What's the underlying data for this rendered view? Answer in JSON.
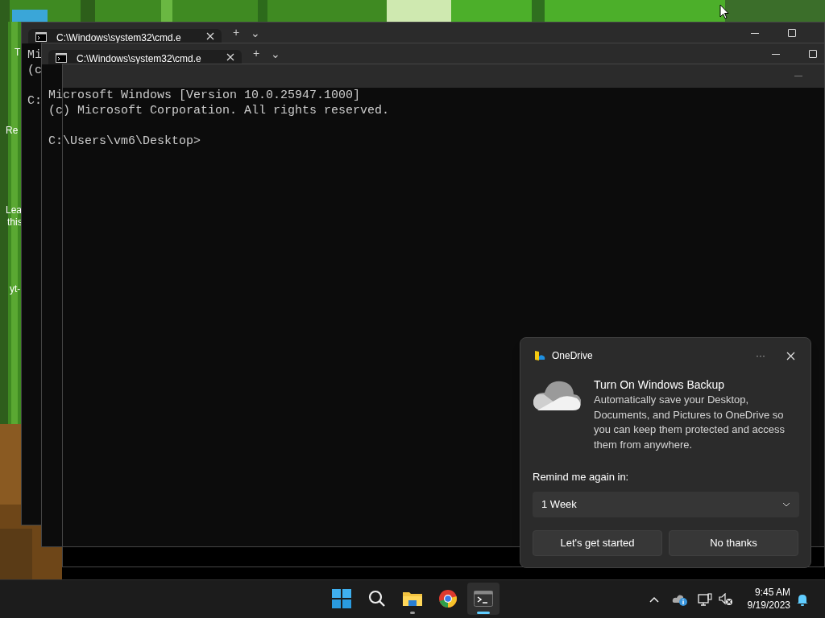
{
  "desktop": {
    "icon_labels": [
      "T",
      "Re",
      "Lea",
      "this",
      "yt-"
    ]
  },
  "windows": [
    {
      "kind": "tabbed",
      "tab_title": "C:\\Windows\\system32\\cmd.e",
      "tab_buttons": [
        "+",
        "⌄"
      ],
      "output": [
        "Mi",
        "(c"
      ],
      "prompt": "C:"
    },
    {
      "kind": "tabbed",
      "tab_title": "C:\\Windows\\system32\\cmd.e",
      "tab_buttons": [
        "+",
        "⌄"
      ],
      "output": [
        "Microsoft Windows [Version 10.0.25947.1000]",
        "(c) Microsoft Corporation. All rights reserved."
      ],
      "prompt": "C:\\Users\\vm6\\Desktop>"
    },
    {
      "kind": "plain"
    }
  ],
  "notification": {
    "app": "OneDrive",
    "more": "···",
    "title": "Turn On Windows Backup",
    "body": "Automatically save your Desktop, Documents, and Pictures to OneDrive so you can keep them protected and access them from anywhere.",
    "remind_label": "Remind me again in:",
    "remind_dropdown": {
      "value": "1 Week"
    },
    "buttons": [
      "Let's get started",
      "No thanks"
    ]
  },
  "taskbar": {
    "apps": [
      {
        "kind": "start",
        "running": false,
        "selected": false
      },
      {
        "kind": "search",
        "running": false,
        "selected": false
      },
      {
        "kind": "explorer",
        "running": true,
        "selected": false
      },
      {
        "kind": "chrome",
        "running": false,
        "selected": false
      },
      {
        "kind": "terminal",
        "running": true,
        "selected": true
      }
    ],
    "time": "9:45 AM",
    "date": "9/19/2023"
  }
}
